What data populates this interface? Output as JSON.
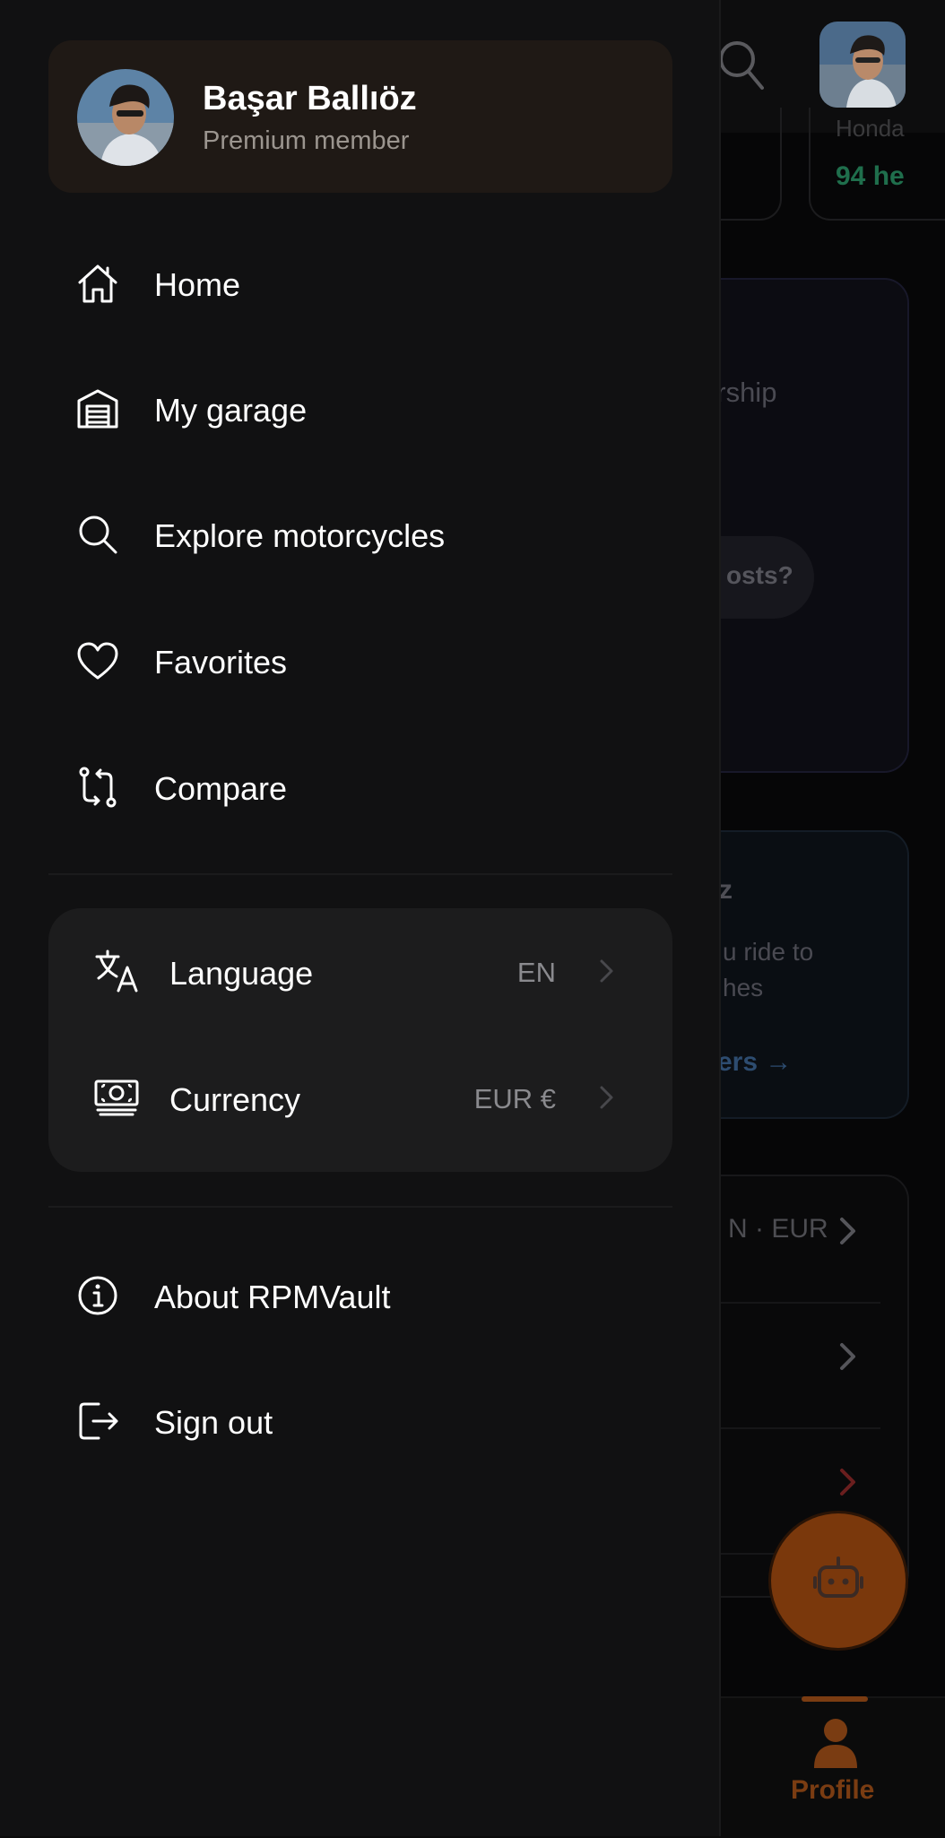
{
  "background_app": {
    "card_top_text": "Honda",
    "card_stat": "94 he",
    "promo_text": "ership",
    "promo_chip": "osts?",
    "dealers_title": "z",
    "dealers_line1": "u ride to",
    "dealers_line2": "hes",
    "dealers_link": "ers →",
    "settings_row1_value": "N · EUR",
    "tab_profile_label": "Profile",
    "accent_color": "#e8671a"
  },
  "drawer": {
    "profile": {
      "name": "Başar Ballıöz",
      "subtitle": "Premium member"
    },
    "menu": [
      {
        "label": "Home",
        "icon": "home-icon"
      },
      {
        "label": "My garage",
        "icon": "garage-icon"
      },
      {
        "label": "Explore motorcycles",
        "icon": "search-icon"
      },
      {
        "label": "Favorites",
        "icon": "heart-icon"
      },
      {
        "label": "Compare",
        "icon": "compare-icon"
      }
    ],
    "settings": {
      "language": {
        "label": "Language",
        "value": "EN"
      },
      "currency": {
        "label": "Currency",
        "value": "EUR €"
      }
    },
    "bottom": [
      {
        "label": "About RPMVault",
        "icon": "info-icon"
      },
      {
        "label": "Sign out",
        "icon": "sign-out-icon"
      }
    ]
  }
}
